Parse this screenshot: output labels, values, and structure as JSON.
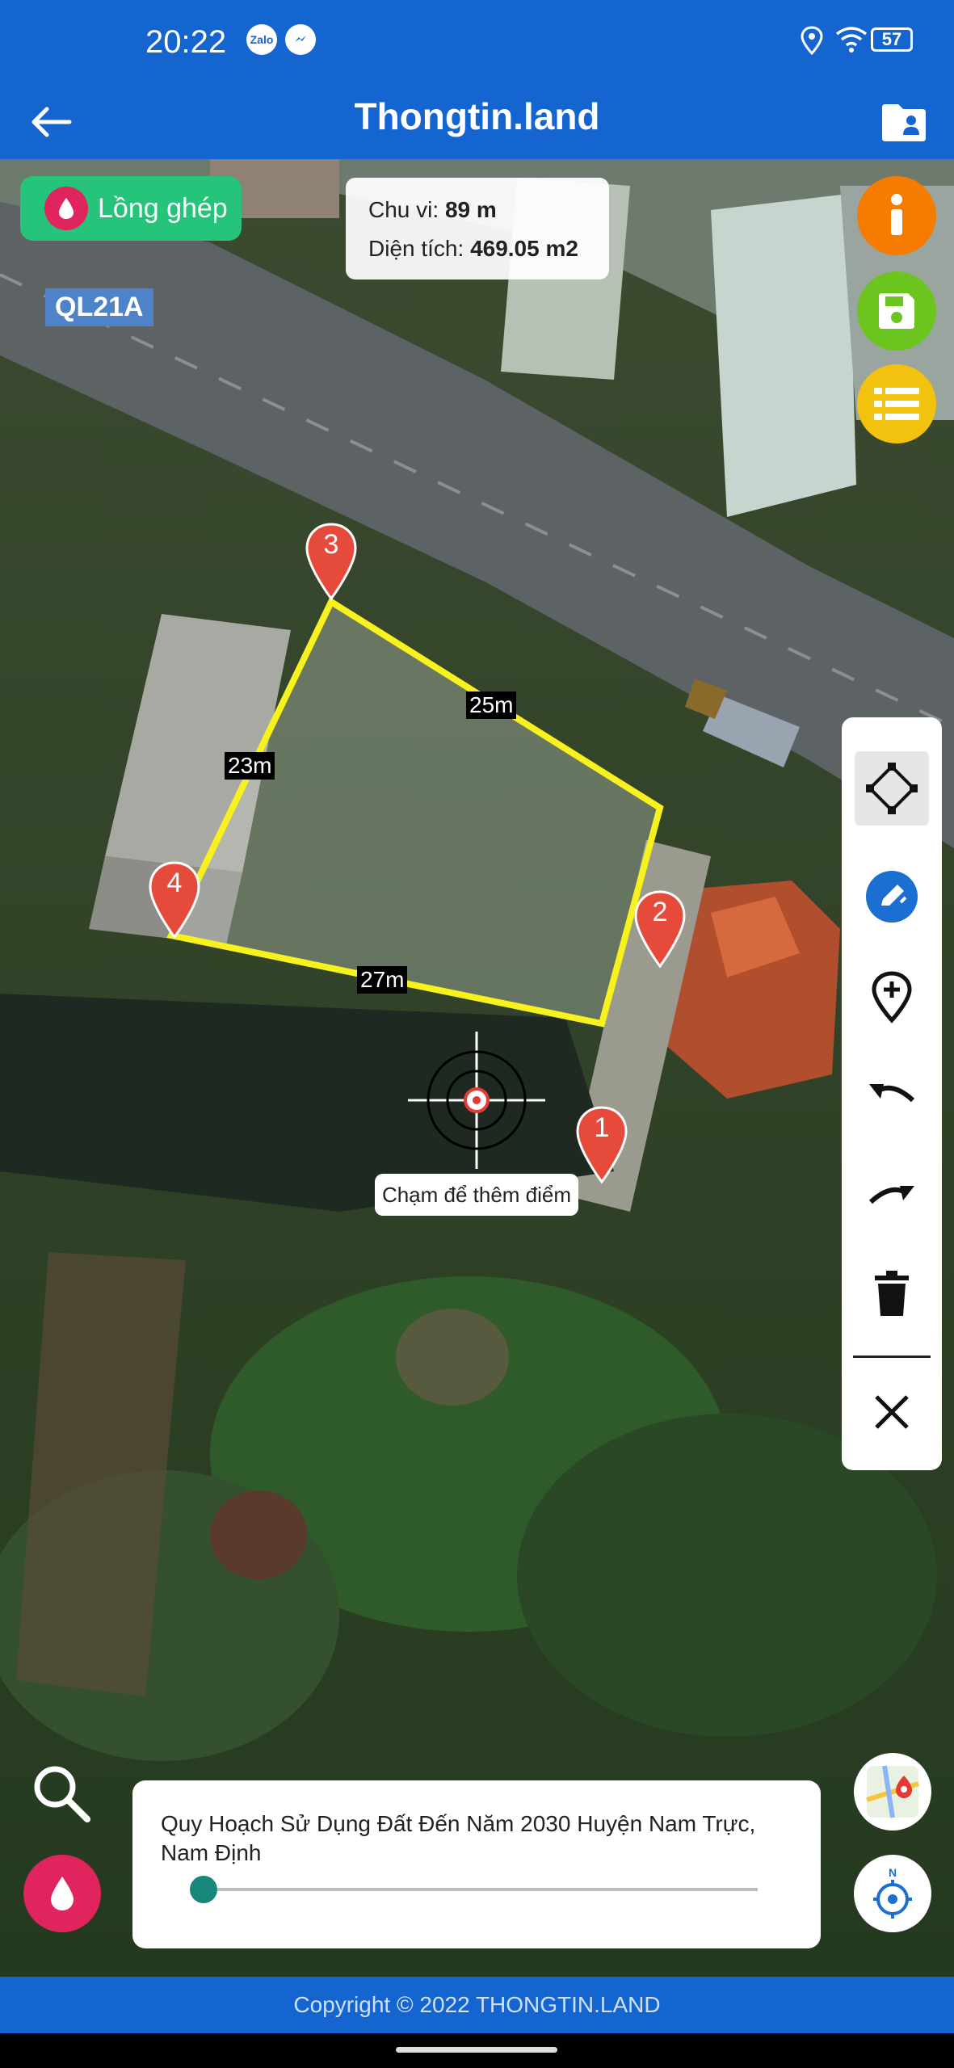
{
  "status_bar": {
    "time": "20:22",
    "battery": "57",
    "icons": [
      "zalo-icon",
      "messenger-icon",
      "location-icon",
      "wifi-icon",
      "battery-icon"
    ],
    "zalo_label": "Zalo"
  },
  "app_bar": {
    "title": "Thongtin.land",
    "back_icon": "arrow-left-icon",
    "folder_icon": "folder-user-icon"
  },
  "map": {
    "road_label": "QL21A",
    "overlay_button": "Lồng ghép",
    "measurement": {
      "perimeter_label": "Chu vi:",
      "perimeter_value": "89 m",
      "area_label": "Diện tích:",
      "area_value": "469.05 m2"
    },
    "markers": [
      "1",
      "2",
      "3",
      "4"
    ],
    "segments": [
      "25m",
      "23m",
      "27m"
    ],
    "crosshair_hint": "Chạm để thêm điểm"
  },
  "fabs": {
    "info_color": "#f57c00",
    "save_color": "#6cc51e",
    "list_color": "#f2c20f"
  },
  "tools": [
    "polygon-icon",
    "edit-icon",
    "add-location-icon",
    "undo-icon",
    "redo-icon",
    "trash-icon",
    "close-icon"
  ],
  "layer": {
    "name": "Quy Hoạch Sử Dụng Đất Đến Năm 2030 Huyện Nam Trực, Nam Định",
    "opacity": 0.02
  },
  "footer": {
    "copyright": "Copyright © 2022 THONGTIN.LAND"
  }
}
